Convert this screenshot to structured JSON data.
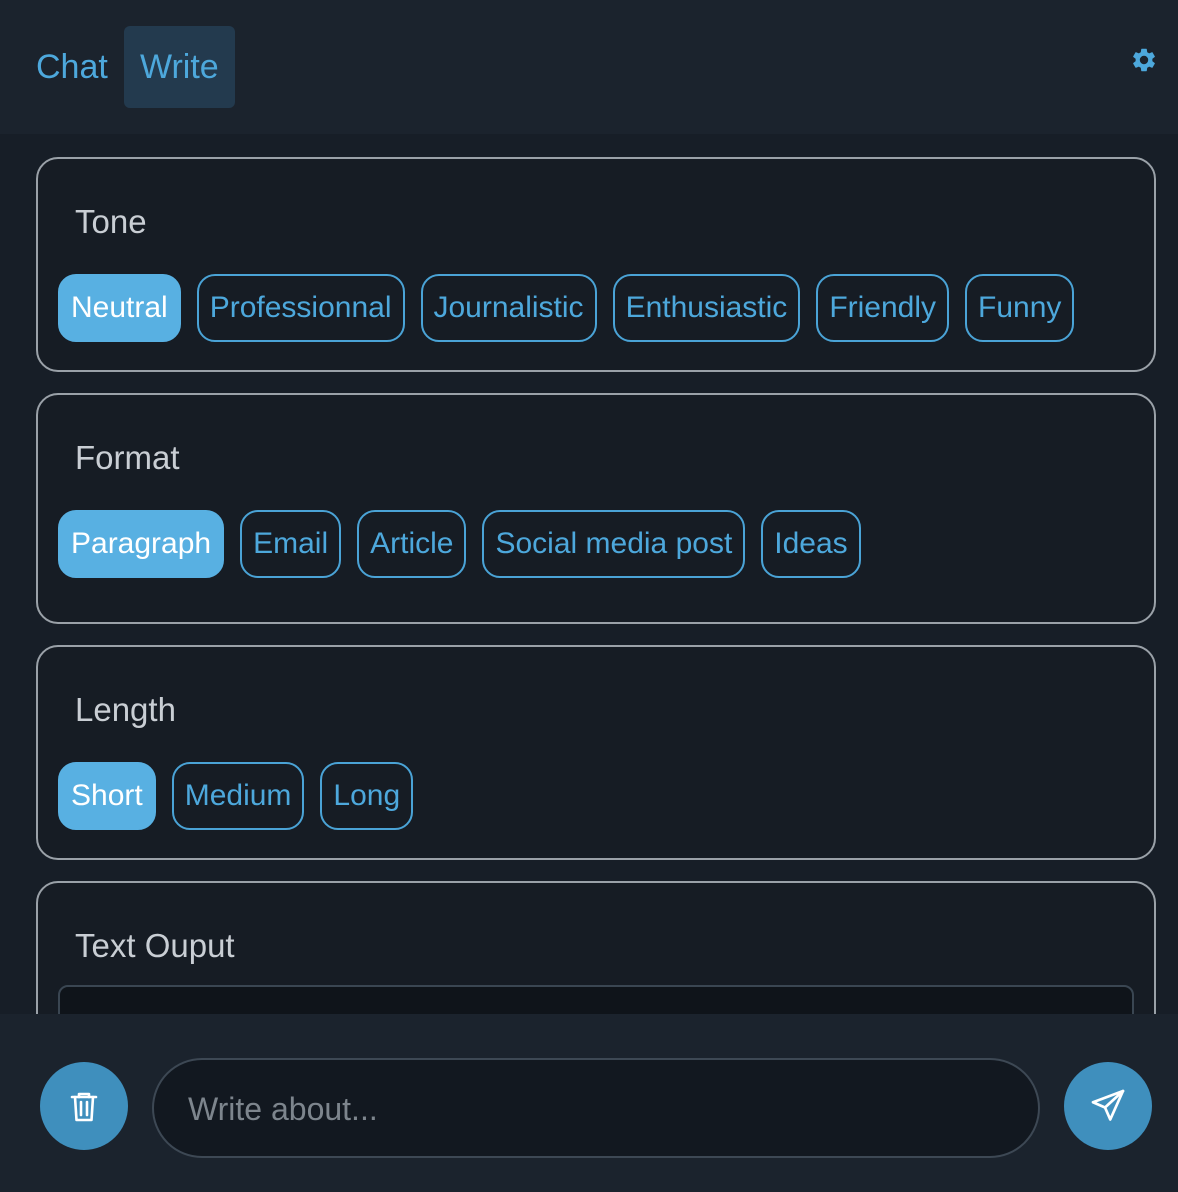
{
  "header": {
    "tabs": [
      {
        "label": "Chat",
        "active": false
      },
      {
        "label": "Write",
        "active": true
      }
    ],
    "settings_icon": "gear-icon"
  },
  "sections": {
    "tone": {
      "title": "Tone",
      "options": [
        "Neutral",
        "Professionnal",
        "Journalistic",
        "Enthusiastic",
        "Friendly",
        "Funny"
      ],
      "selected": "Neutral"
    },
    "format": {
      "title": "Format",
      "options": [
        "Paragraph",
        "Email",
        "Article",
        "Social media post",
        "Ideas"
      ],
      "selected": "Paragraph"
    },
    "length": {
      "title": "Length",
      "options": [
        "Short",
        "Medium",
        "Long"
      ],
      "selected": "Short"
    },
    "output": {
      "title": "Text Ouput",
      "value": ""
    }
  },
  "footer": {
    "clear_icon": "trash-icon",
    "input_placeholder": "Write about...",
    "input_value": "",
    "send_icon": "send-icon"
  },
  "colors": {
    "accent": "#58b0e2",
    "tab_active_bg": "#233a4e",
    "button_bg": "#3f8fbd",
    "background": "#171e27"
  }
}
